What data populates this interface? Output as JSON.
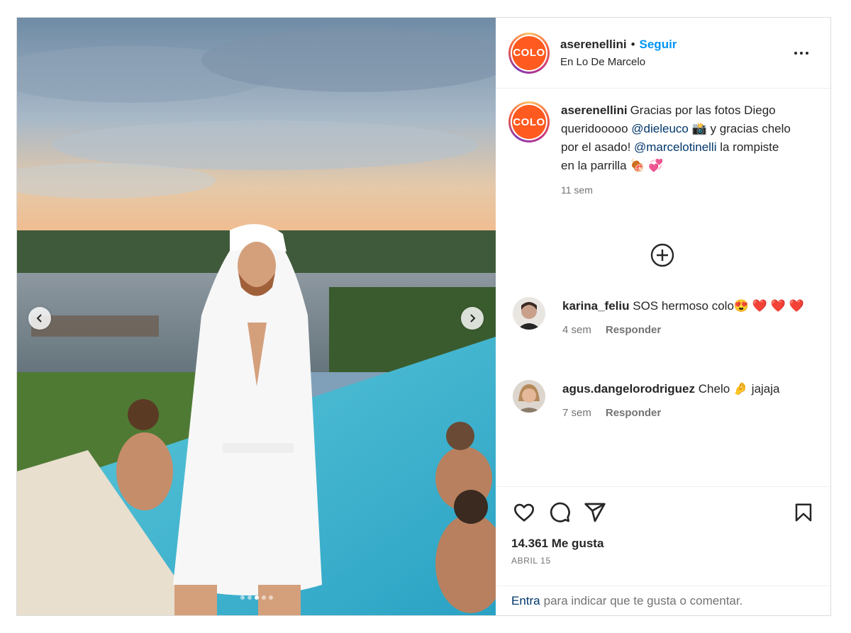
{
  "post": {
    "author": {
      "username": "aserenellini",
      "avatar_text": "COLO",
      "location": "En Lo De Marcelo"
    },
    "header": {
      "bullet": "•",
      "follow_label": "Seguir"
    },
    "caption": {
      "username": "aserenellini",
      "text_1": "Gracias por las fotos Diego queridooooo ",
      "mention_1": "@dieleuco",
      "text_2": " 📸 y gracias chelo por el asado! ",
      "mention_2": "@marcelotinelli",
      "text_3": " la rompiste en la parrilla 🍖 💞",
      "time": "11 sem"
    },
    "comments": [
      {
        "username": "karina_feliu",
        "text": "SOS hermoso colo😍 ❤️ ❤️ ❤️",
        "time": "4 sem",
        "reply_label": "Responder"
      },
      {
        "username": "agus.dangelorodriguez",
        "text": "Chelo 🤌 jajaja",
        "time": "7 sem",
        "reply_label": "Responder"
      }
    ],
    "likes": "14.361 Me gusta",
    "date": "ABRIL 15",
    "footer": {
      "login_label": "Entra",
      "rest": "para indicar que te gusta o comentar."
    },
    "carousel": {
      "slide_count": 5,
      "active_index": 2
    },
    "icons": [
      "more-options-icon",
      "add-circle-icon",
      "heart-icon",
      "comment-icon",
      "share-icon",
      "bookmark-icon",
      "chevron-left-icon",
      "chevron-right-icon"
    ],
    "colors": {
      "follow": "#0095f6",
      "mention": "#00376b",
      "avatar_bg": "#ff5a1f",
      "muted": "#737373"
    }
  }
}
